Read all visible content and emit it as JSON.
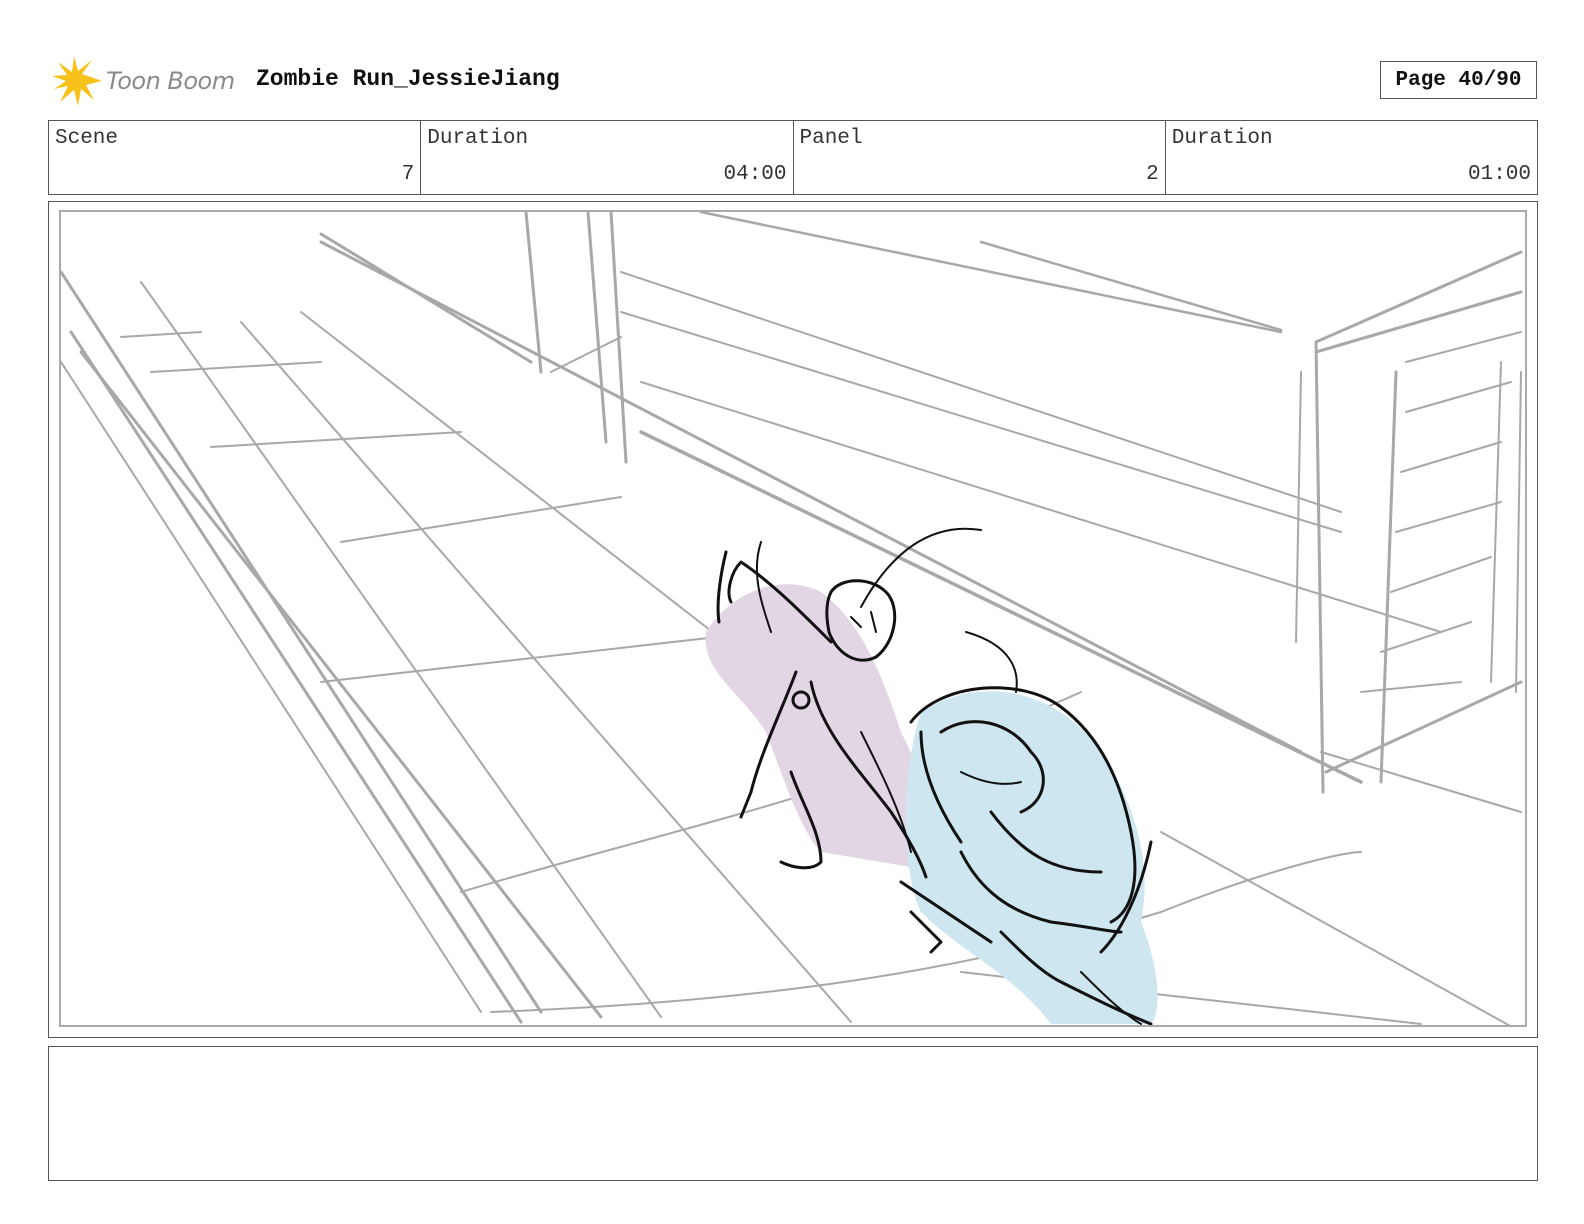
{
  "header": {
    "logo_text": "Toon Boom",
    "project_title": "Zombie Run_JessieJiang",
    "page_label": "Page 40/90"
  },
  "info": {
    "scene_label": "Scene",
    "scene_value": "7",
    "scene_duration_label": "Duration",
    "scene_duration_value": "04:00",
    "panel_label": "Panel",
    "panel_value": "2",
    "panel_duration_label": "Duration",
    "panel_duration_value": "01:00"
  },
  "colors": {
    "logo_yellow": "#f6c21a",
    "sketch_gray": "#a8a8a8",
    "character_pink": "#e3d6e4",
    "character_blue": "#cde6f0"
  }
}
